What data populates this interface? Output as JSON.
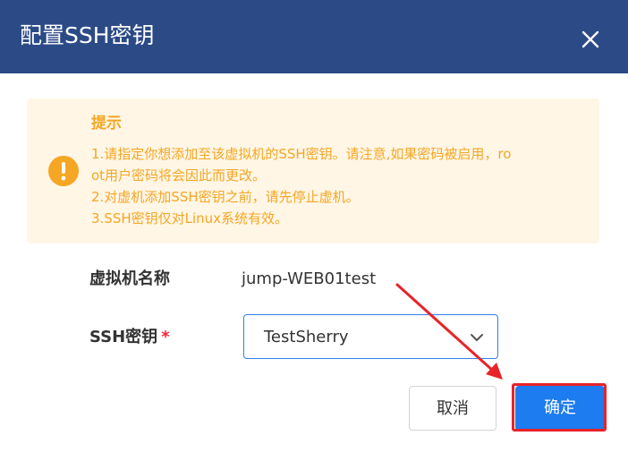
{
  "dialog": {
    "title": "配置SSH密钥",
    "close_icon": "close-icon"
  },
  "notice": {
    "icon": "warning-icon",
    "title": "提示",
    "lines": [
      "1.请指定你想添加至该虚拟机的SSH密钥。请注意,如果密码被启用，ro",
      "ot用户密码将会因此而更改。",
      "2.对虚机添加SSH密钥之前，请先停止虚机。",
      "3.SSH密钥仅对Linux系统有效。"
    ],
    "color": "#f5a623",
    "background": "#fff6e6"
  },
  "form": {
    "vm_name_label": "虚拟机名称",
    "vm_name_value": "jump-WEB01test",
    "ssh_key_label": "SSH密钥",
    "ssh_key_required": "*",
    "ssh_key_selected": "TestSherry",
    "select_icon": "chevron-down-icon"
  },
  "buttons": {
    "cancel": "取消",
    "confirm": "确定"
  },
  "colors": {
    "header": "#2b4a86",
    "primary": "#1c7cf0",
    "annotation": "#e8232a"
  }
}
